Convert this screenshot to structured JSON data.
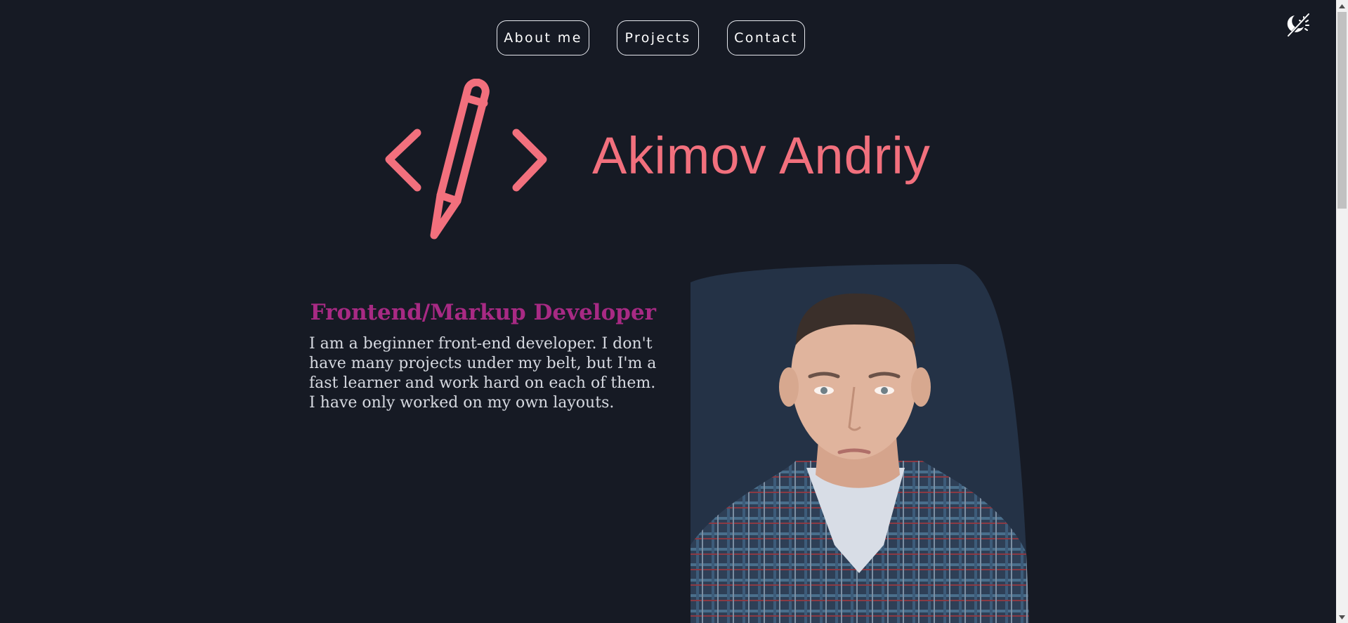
{
  "nav": {
    "about_label": "About me",
    "projects_label": "Projects",
    "contact_label": "Contact"
  },
  "theme_toggle": {
    "icon": "moon-sun-icon"
  },
  "hero": {
    "logo_icon": "code-pencil-icon",
    "name": "Akimov Andriy"
  },
  "about": {
    "role": "Frontend/Markup Developer",
    "bio": "I am a beginner front-end developer. I don't have many projects under my belt, but I'm a fast learner and work hard on each of them. I have only worked on my own layouts."
  },
  "photo": {
    "icon": "profile-photo"
  },
  "colors": {
    "background": "#161a24",
    "accent": "#f2707d",
    "role": "#a82a84",
    "photo_panel": "#243246"
  }
}
